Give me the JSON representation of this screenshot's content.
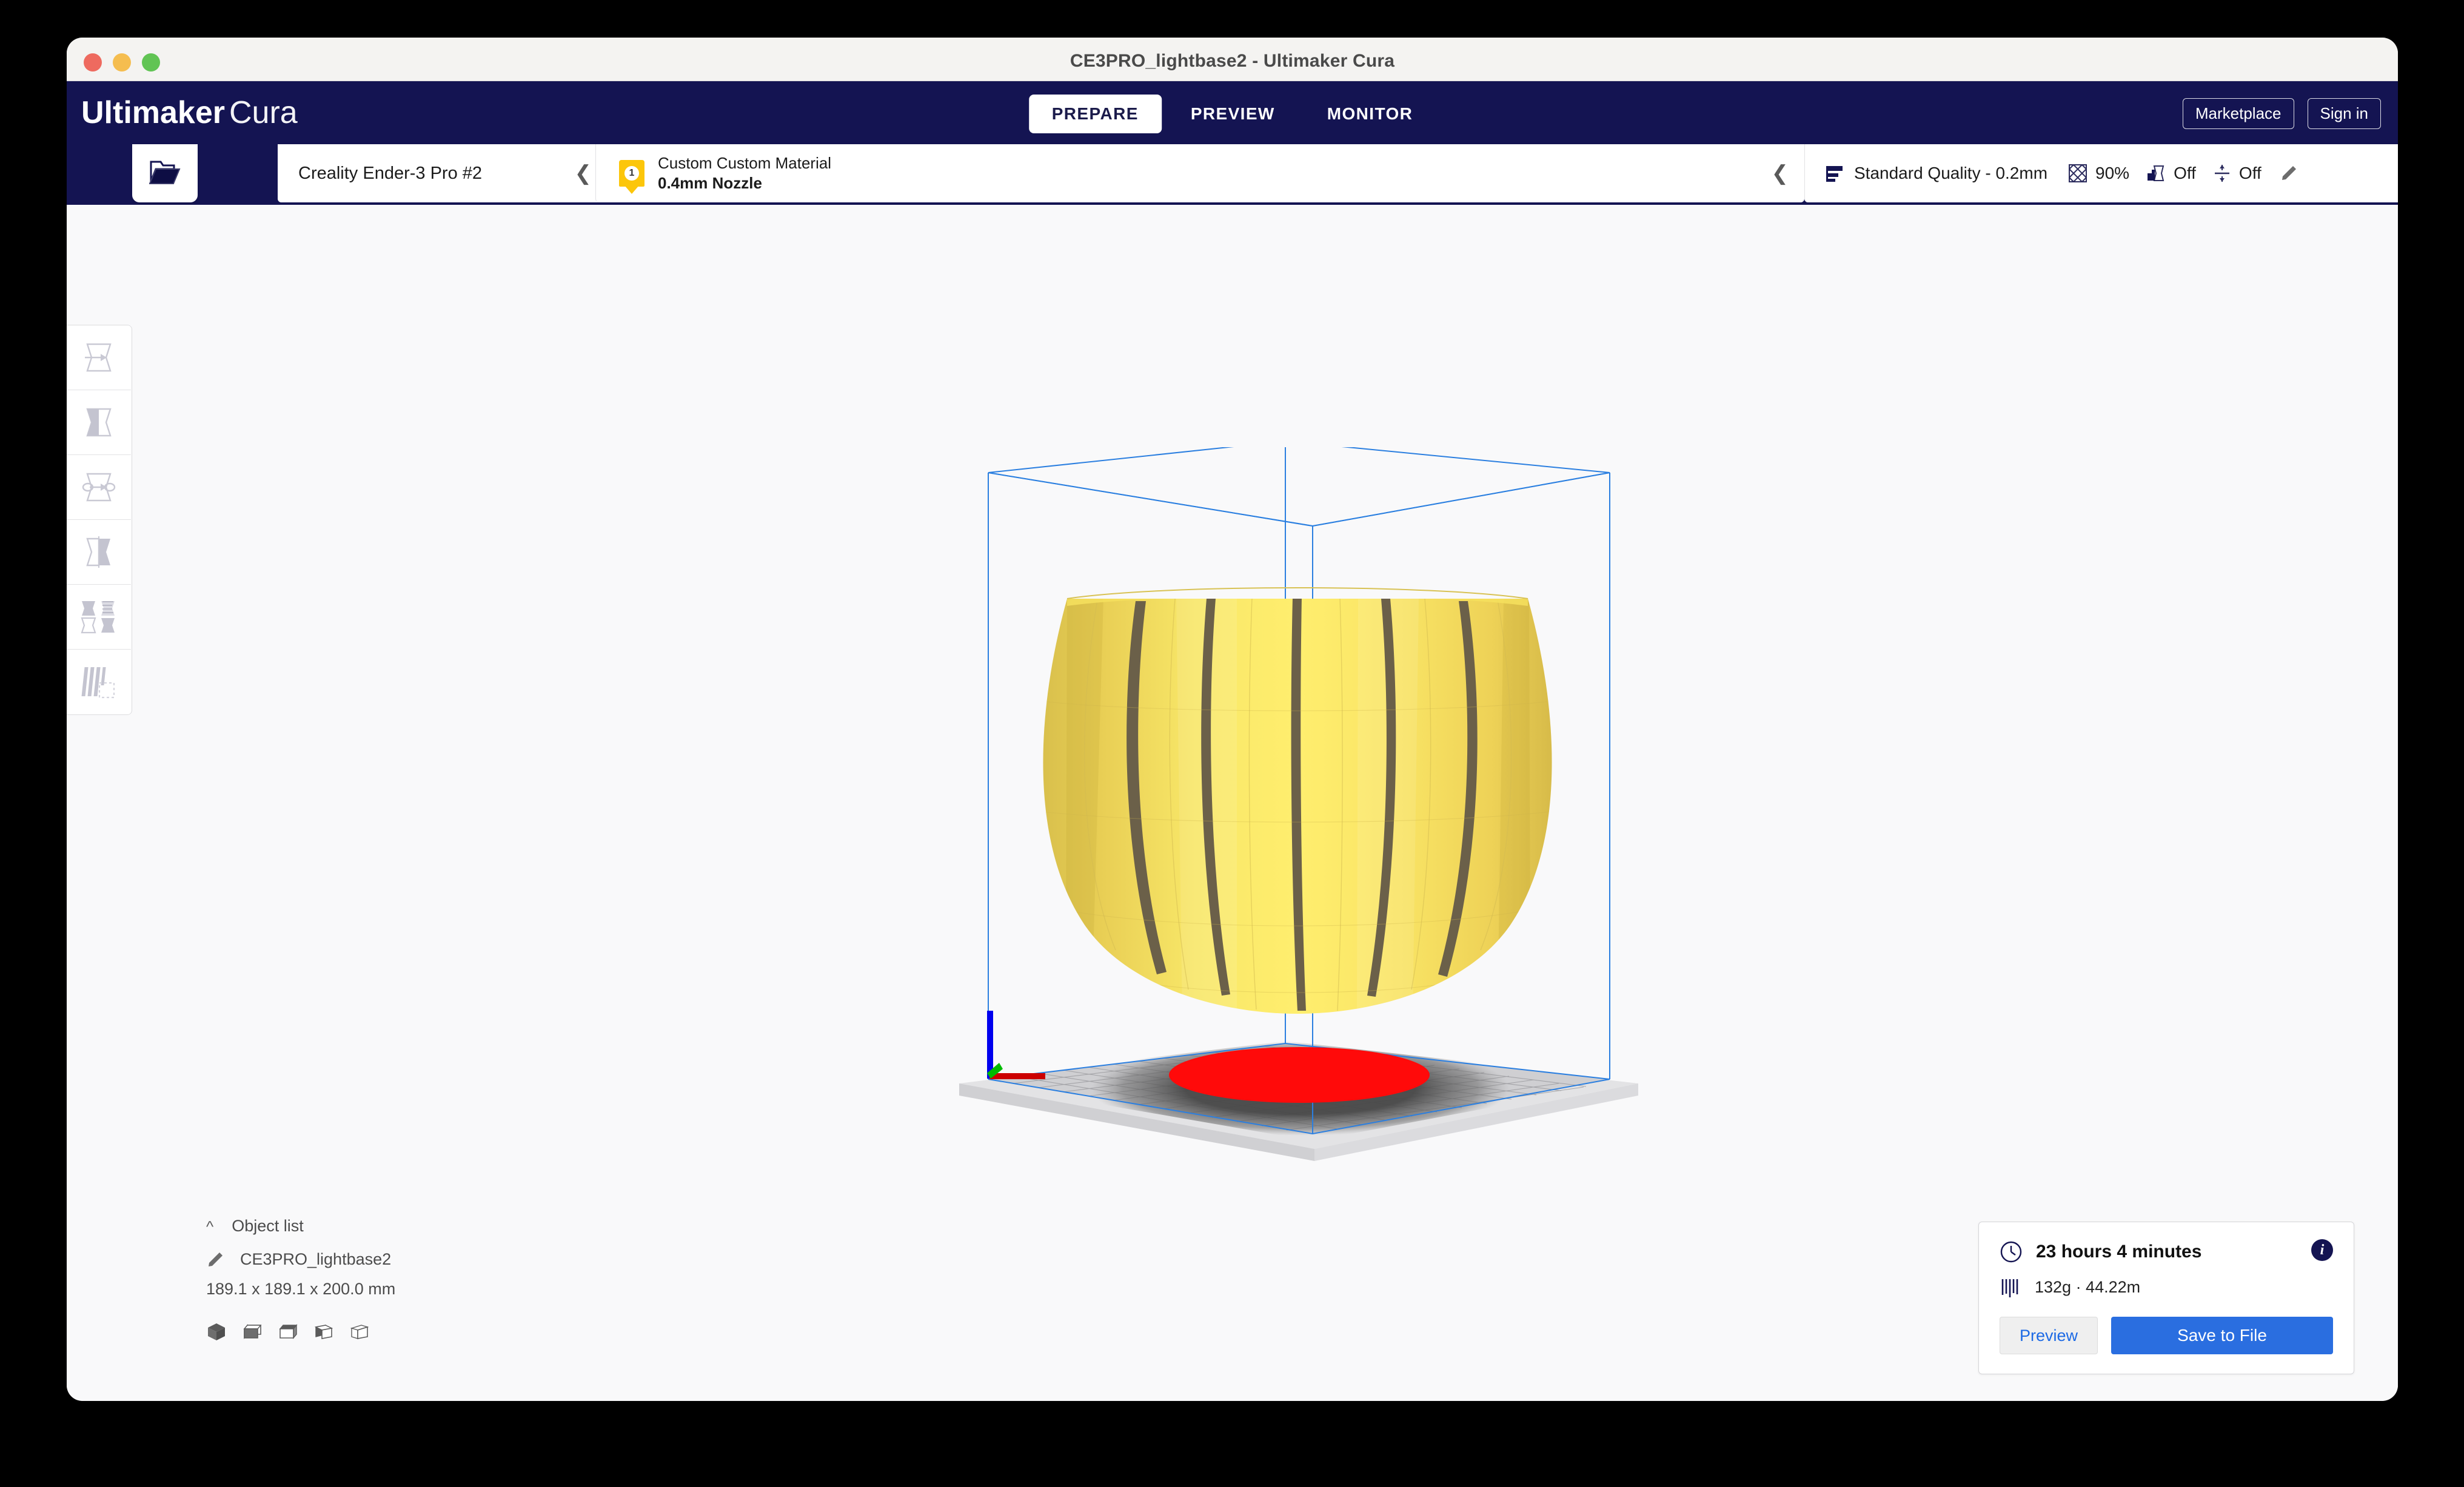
{
  "window": {
    "title": "CE3PRO_lightbase2 - Ultimaker Cura"
  },
  "header": {
    "logo_bold": "Ultimaker",
    "logo_light": "Cura",
    "tabs": [
      {
        "label": "PREPARE",
        "active": true
      },
      {
        "label": "PREVIEW",
        "active": false
      },
      {
        "label": "MONITOR",
        "active": false
      }
    ],
    "marketplace_label": "Marketplace",
    "signin_label": "Sign in",
    "background_color": "#141452"
  },
  "configbar": {
    "open_file_icon": "open-folder-icon",
    "printer": {
      "name": "Creality Ender-3 Pro #2",
      "collapse_icon": "chevron-left-icon"
    },
    "material": {
      "extruder_number": "1",
      "name": "Custom Custom Material",
      "nozzle": "0.4mm Nozzle",
      "badge_color": "#fcc60a",
      "collapse_icon": "chevron-left-icon"
    },
    "quality": {
      "profile": "Standard Quality - 0.2mm",
      "infill_value": "90%",
      "support_value": "Off",
      "adhesion_value": "Off",
      "edit_icon": "pencil-icon"
    }
  },
  "tools": [
    {
      "name": "move-tool",
      "icon": "move-icon"
    },
    {
      "name": "scale-tool",
      "icon": "scale-icon"
    },
    {
      "name": "rotate-tool",
      "icon": "rotate-icon"
    },
    {
      "name": "mirror-tool",
      "icon": "mirror-icon"
    },
    {
      "name": "per-model-settings-tool",
      "icon": "per-model-settings-icon"
    },
    {
      "name": "support-blocker-tool",
      "icon": "support-blocker-icon"
    }
  ],
  "object_list": {
    "caret": "⌃",
    "title": "Object list",
    "item_name": "CE3PRO_lightbase2",
    "item_icon": "pencil-icon",
    "dimensions": "189.1 x 189.1 x 200.0 mm",
    "view_buttons": [
      {
        "name": "view-3d",
        "label": "3D View"
      },
      {
        "name": "view-front",
        "label": "Front View"
      },
      {
        "name": "view-top",
        "label": "Top View"
      },
      {
        "name": "view-left",
        "label": "Left View"
      },
      {
        "name": "view-right",
        "label": "Right View"
      }
    ]
  },
  "print_info": {
    "time": "23 hours 4 minutes",
    "material": "132g · 44.22m",
    "clock_icon": "clock-icon",
    "spool_icon": "filament-icon",
    "info_icon": "info-icon",
    "preview_label": "Preview",
    "save_label": "Save to File",
    "save_color": "#2a6ee0",
    "preview_text_color": "#1d6ae5"
  },
  "viewport": {
    "background_color": "#f9f9fa",
    "build_volume_color": "#2b7fe0",
    "model_color": "#f5dc4b",
    "overhang_color": "#ff0a0a",
    "plate_color": "#d4d4d6",
    "axis_x_color": "#cc0000",
    "axis_y_color": "#00bb00",
    "axis_z_color": "#0000ee"
  }
}
